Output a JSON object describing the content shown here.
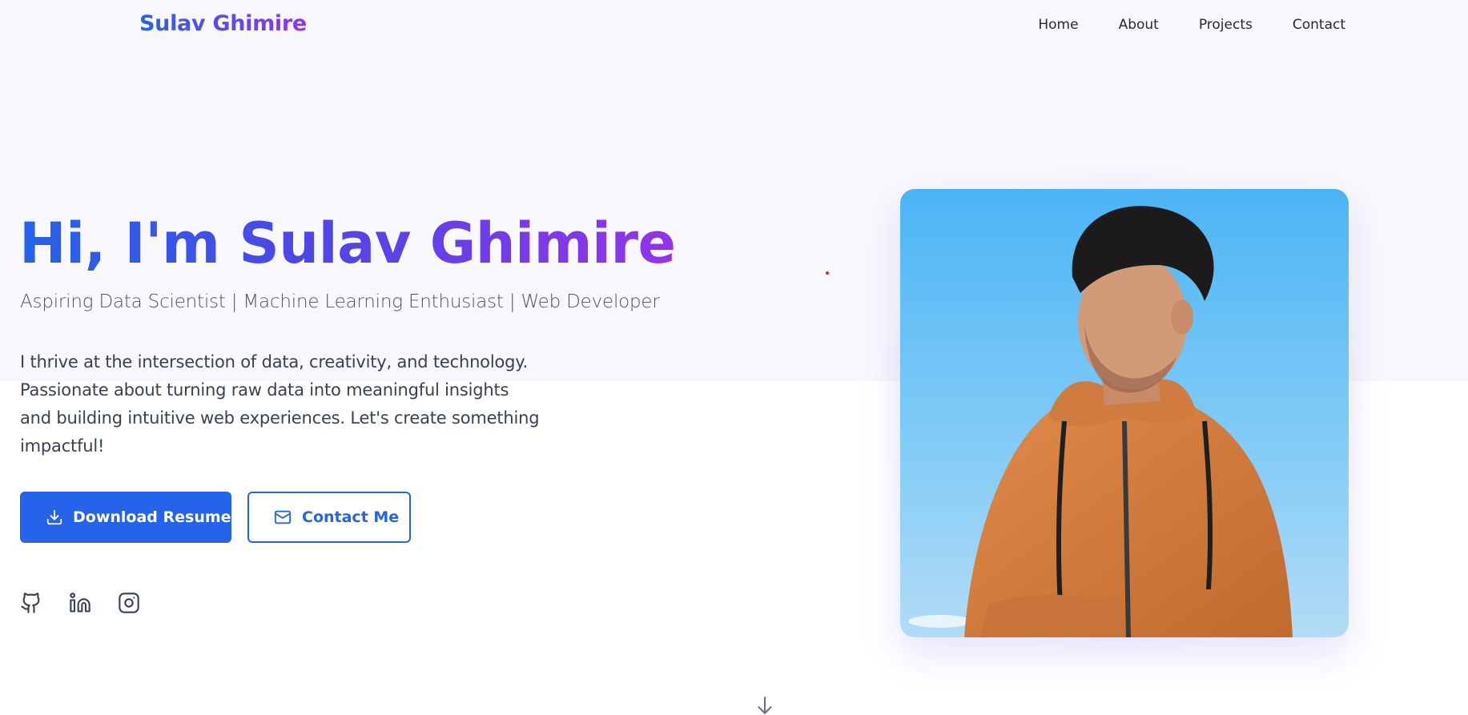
{
  "nav": {
    "logo": "Sulav Ghimire",
    "links": [
      "Home",
      "About",
      "Projects",
      "Contact"
    ]
  },
  "hero": {
    "title": "Hi, I'm Sulav Ghimire",
    "subtitle": "Aspiring Data Scientist | Machine Learning Enthusiast | Web Developer",
    "description": "I thrive at the intersection of data, creativity, and technology. Passionate about turning raw data into meaningful insights and building intuitive web experiences. Let's create something impactful!",
    "buttons": {
      "download": "Download Resume",
      "contact": "Contact Me"
    },
    "socials": [
      "github-icon",
      "linkedin-icon",
      "instagram-icon"
    ]
  },
  "photo": {
    "alt": "Portrait of Sulav Ghimire in an orange hoodie against a blue sky"
  },
  "colors": {
    "primary": "#2563eb",
    "gradient_start": "#2563eb",
    "gradient_end": "#9333ea",
    "text": "#374151"
  }
}
